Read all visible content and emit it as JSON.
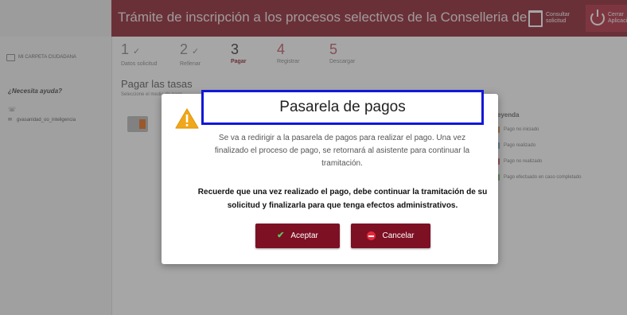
{
  "header": {
    "title": "Trámite de inscripción a los procesos selectivos de la Conselleria de Sanidad Universal y",
    "consult_label": "Consultar solicitud",
    "exit_label": "Cerrar Aplicación"
  },
  "sidebar": {
    "link_label": "MI CARPETA CIUDADANA",
    "help_title": "¿Necesita ayuda?",
    "phone": "☏",
    "email_icon": "✉",
    "email": "gvasanidad_oo_inteligencia"
  },
  "steps": [
    {
      "num": "1",
      "mark": "✓",
      "label": "Datos solicitud"
    },
    {
      "num": "2",
      "mark": "✓",
      "label": "Rellenar"
    },
    {
      "num": "3",
      "mark": "",
      "label": "Pagar"
    },
    {
      "num": "4",
      "mark": "",
      "label": "Registrar"
    },
    {
      "num": "5",
      "mark": "",
      "label": "Descargar"
    }
  ],
  "content": {
    "title": "Pagar las tasas",
    "subtitle": "Seleccione el medio de pago"
  },
  "legend": {
    "title": "Leyenda",
    "items": [
      {
        "label": "Pago no iniciado",
        "color": "#e08a4a"
      },
      {
        "label": "Pago realizado",
        "color": "#7aa4cf"
      },
      {
        "label": "Pago no realizado",
        "color": "#d75a6a"
      },
      {
        "label": "Pago efectuado en caso completado",
        "color": "#7fb86d"
      }
    ]
  },
  "modal": {
    "title": "Pasarela de pagos",
    "message": "Se va a redirigir a la pasarela de pagos para realizar el pago. Una vez finalizado el proceso de pago, se retornará al asistente para continuar la tramitación.",
    "notice": "Recuerde que una vez realizado el pago, debe continuar la tramitación de su solicitud y finalizarla para que tenga efectos administrativos.",
    "accept_label": "Aceptar",
    "cancel_label": "Cancelar"
  },
  "colors": {
    "brand": "#8c1d2c",
    "button": "#7d1023",
    "highlight_border": "#1118d8",
    "warning": "#f0a71b"
  },
  "icons": {
    "warning": "warning-triangle-icon",
    "accept": "checkmark-icon",
    "cancel": "minus-circle-icon",
    "consult": "trash-icon",
    "exit": "power-icon"
  }
}
